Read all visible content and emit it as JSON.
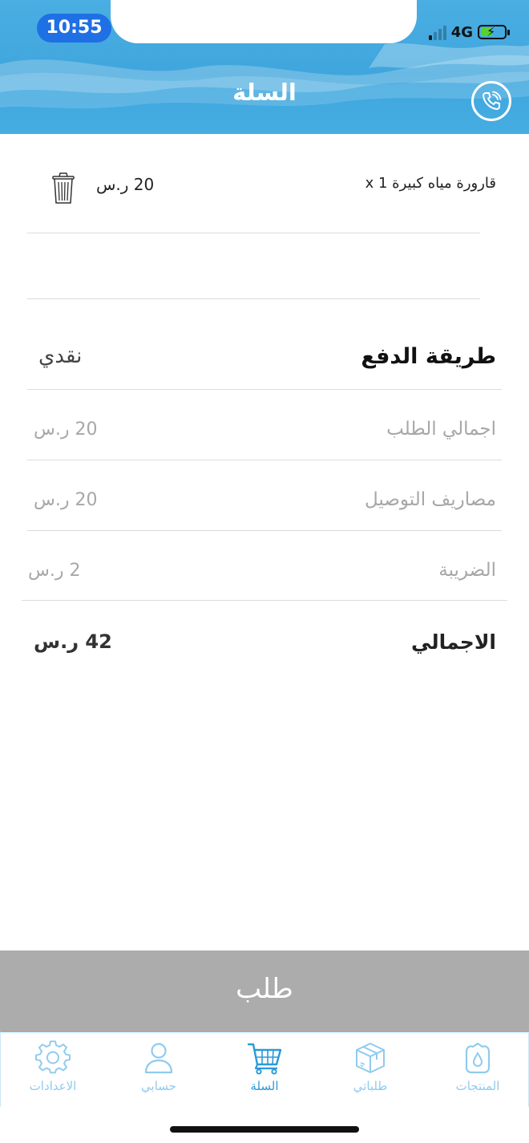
{
  "status_bar": {
    "time": "10:55",
    "network": "4G"
  },
  "header": {
    "title": "السلة"
  },
  "cart": {
    "items": [
      {
        "name": "قارورة مياه كبيرة x 1",
        "price": "20 ر.س"
      }
    ]
  },
  "summary": {
    "payment_method_label": "طريقة الدفع",
    "payment_method_value": "نقدي",
    "order_total_label": "اجمالي الطلب",
    "order_total_value": "20 ر.س",
    "delivery_label": "مصاريف التوصيل",
    "delivery_value": "20 ر.س",
    "tax_label": "الضريبة",
    "tax_value": "2 ر.س",
    "grand_total_label": "الاجمالي",
    "grand_total_value": "42 ر.س"
  },
  "order_button": {
    "label": "طلب"
  },
  "tabs": [
    {
      "label": "المنتجات",
      "icon": "drop-box-icon"
    },
    {
      "label": "طلباتي",
      "icon": "package-icon"
    },
    {
      "label": "السلة",
      "icon": "cart-icon",
      "active": true
    },
    {
      "label": "حسابي",
      "icon": "user-icon"
    },
    {
      "label": "الاعدادات",
      "icon": "gear-icon"
    }
  ],
  "colors": {
    "accent": "#3fa6dd",
    "tab_inactive": "#8fcbee",
    "tab_active": "#2a9ad8",
    "order_button": "#acacac"
  }
}
